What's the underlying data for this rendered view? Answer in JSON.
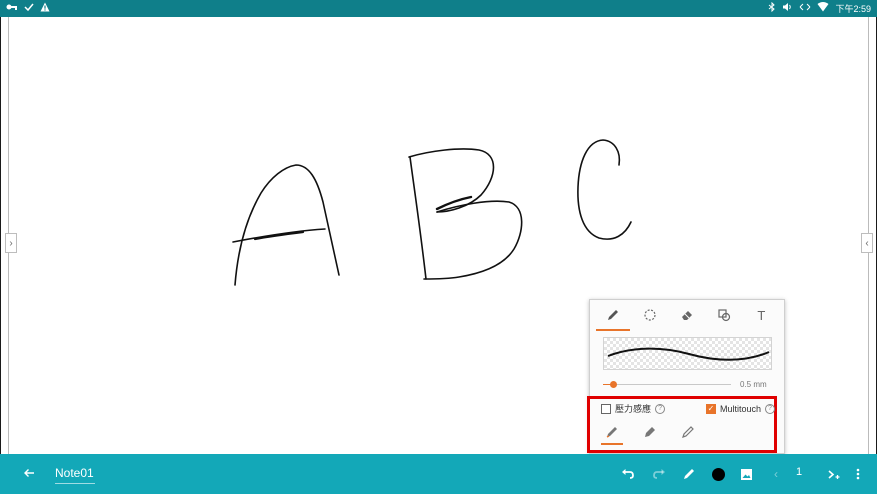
{
  "status_bar": {
    "left_icons": [
      "vpn-key-icon",
      "check-icon",
      "warning-icon"
    ],
    "right_icons": [
      "bluetooth-icon",
      "volume-icon",
      "sync-icon",
      "wifi-icon"
    ],
    "time": "下午2:59"
  },
  "pen_panel": {
    "tools": [
      {
        "name": "pen",
        "icon": "pen-icon",
        "active": true
      },
      {
        "name": "lasso",
        "icon": "lasso-icon",
        "active": false
      },
      {
        "name": "eraser",
        "icon": "eraser-icon",
        "active": false
      },
      {
        "name": "shapes",
        "icon": "shape-icon",
        "active": false
      },
      {
        "name": "text",
        "icon": "text-icon",
        "label": "T",
        "active": false
      }
    ],
    "thickness_value": "0.5 mm",
    "thickness_fraction": 0.08,
    "pressure": {
      "label": "壓力感應",
      "checked": false
    },
    "multitouch": {
      "label": "Multitouch",
      "checked": true
    },
    "pen_types": [
      "fountain-pen-icon",
      "marker-icon",
      "pencil-icon"
    ]
  },
  "toolbar": {
    "note_title": "Note01",
    "page_number": "1",
    "current_color": "#000000"
  },
  "colors": {
    "status_bar": "#0f7f8a",
    "toolbar": "#13a8b8",
    "accent": "#e8742a",
    "highlight": "#e00000"
  }
}
